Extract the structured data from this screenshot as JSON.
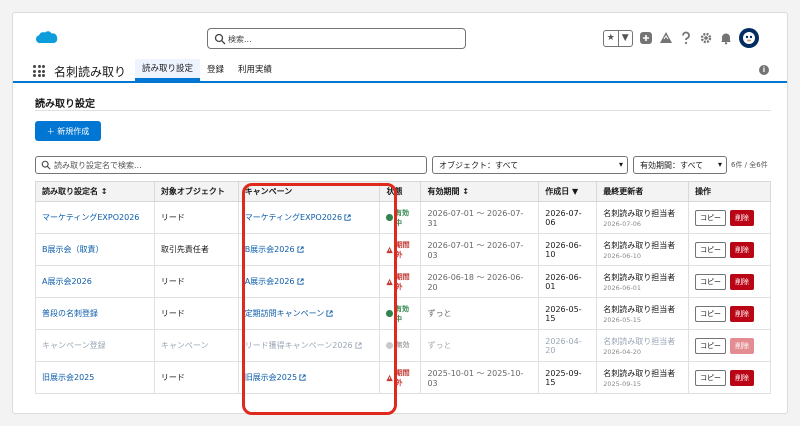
{
  "header": {
    "search_placeholder": "検索...",
    "fav_star": "★",
    "fav_caret": "▼"
  },
  "nav": {
    "app_name": "名刺読み取り",
    "tabs": [
      {
        "label": "読み取り設定",
        "active": true
      },
      {
        "label": "登録",
        "active": false
      },
      {
        "label": "利用実績",
        "active": false
      }
    ]
  },
  "page": {
    "title": "読み取り設定",
    "new_button": "＋ 新規作成",
    "filter_placeholder": "読み取り設定名で検索...",
    "object_select": "オブジェクト：すべて",
    "period_select": "有効期間：すべて",
    "count": "6件 / 全6件"
  },
  "table": {
    "headers": [
      "読み取り設定名 ↕",
      "対象オブジェクト",
      "キャンペーン",
      "状態",
      "有効期間 ↕",
      "作成日 ▼",
      "最終更新者",
      "操作"
    ],
    "copy_label": "コピー",
    "delete_label": "削除",
    "rows": [
      {
        "name": "マーケティングEXPO2026",
        "object": "リード",
        "campaign": "マーケティングEXPO2026",
        "status": "有効中",
        "status_type": "ok",
        "period": "2026-07-01 〜 2026-07-31",
        "created": "2026-07-06",
        "updater": "名刺読み取り担当者",
        "updated": "2026-07-06"
      },
      {
        "name": "B展示会（取責）",
        "object": "取引先責任者",
        "campaign": "B展示会2026",
        "status": "期間外",
        "status_type": "ng",
        "period": "2026-07-01 〜 2026-07-03",
        "created": "2026-06-10",
        "updater": "名刺読み取り担当者",
        "updated": "2026-06-10"
      },
      {
        "name": "A展示会2026",
        "object": "リード",
        "campaign": "A展示会2026",
        "status": "期間外",
        "status_type": "ng",
        "period": "2026-06-18 〜 2026-06-20",
        "created": "2026-06-01",
        "updater": "名刺読み取り担当者",
        "updated": "2026-06-01"
      },
      {
        "name": "普段の名刺登録",
        "object": "リード",
        "campaign": "定期訪問キャンペーン",
        "status": "有効中",
        "status_type": "ok",
        "period": "ずっと",
        "created": "2026-05-15",
        "updater": "名刺読み取り担当者",
        "updated": "2026-05-15"
      },
      {
        "name": "キャンペーン登録",
        "object": "キャンペーン",
        "campaign": "リード獲得キャンペーン2026",
        "status": "無効",
        "status_type": "na",
        "period": "ずっと",
        "created": "2026-04-20",
        "updater": "名刺読み取り担当者",
        "updated": "2026-04-20"
      },
      {
        "name": "旧展示会2025",
        "object": "リード",
        "campaign": "旧展示会2025",
        "status": "期間外",
        "status_type": "ng",
        "period": "2025-10-01 〜 2025-10-03",
        "created": "2025-09-15",
        "updater": "名刺読み取り担当者",
        "updated": "2025-09-15"
      }
    ]
  },
  "colors": {
    "brand": "#0176d3",
    "highlight": "#e0291d",
    "danger": "#ba0517",
    "active": "#2e844a"
  }
}
